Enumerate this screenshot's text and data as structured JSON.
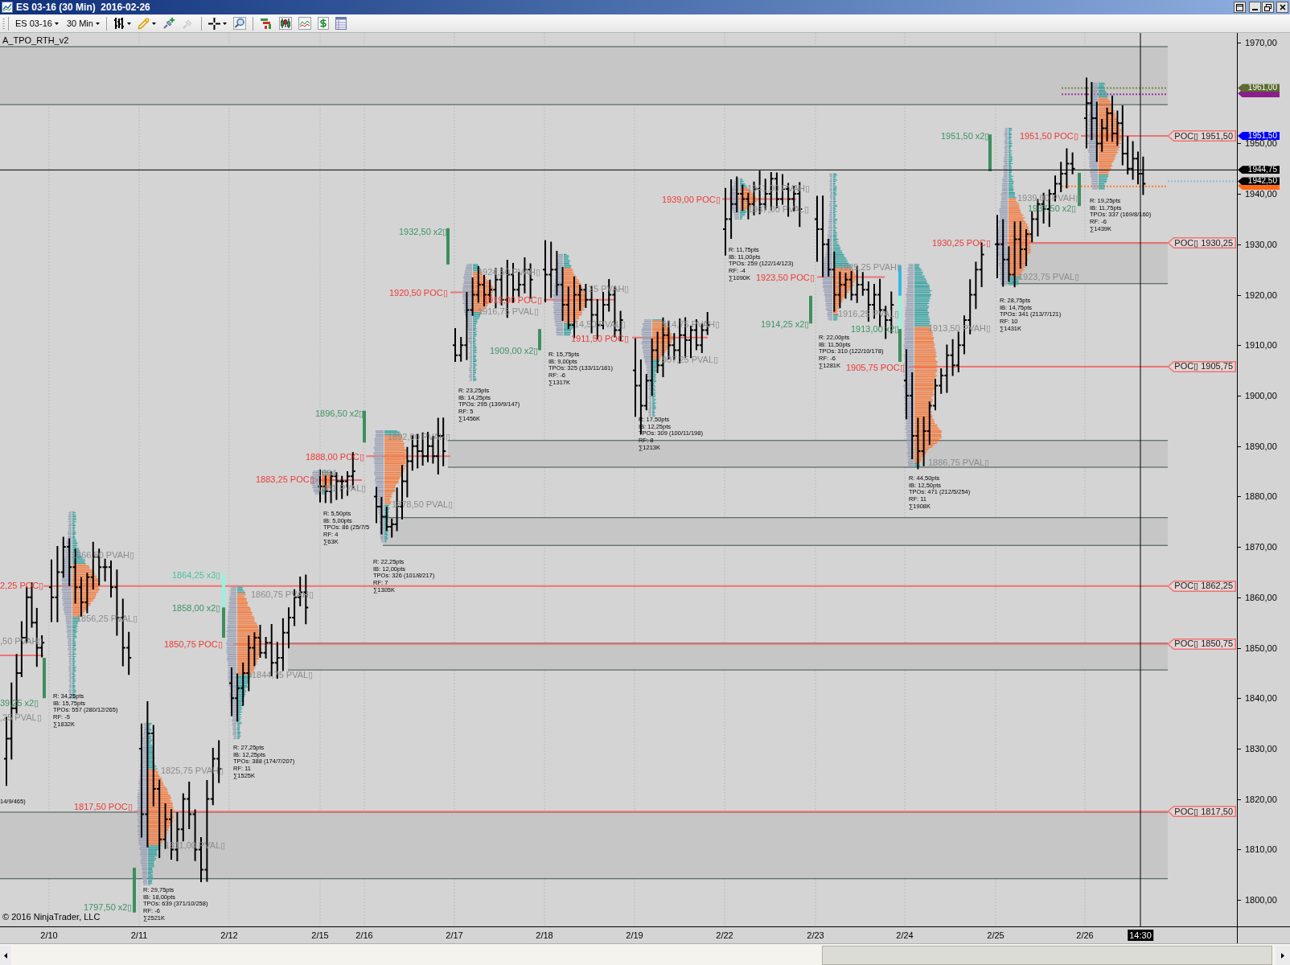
{
  "window": {
    "title": "ES 03-16 (30 Min)  2016-02-26"
  },
  "toolbar": {
    "instrument": "ES 03-16",
    "interval": "30 Min",
    "tools": [
      {
        "kind": "bar-style",
        "disabled": false,
        "dropdown": true
      },
      {
        "kind": "draw",
        "disabled": false,
        "dropdown": true
      },
      {
        "kind": "add-pin",
        "disabled": false,
        "dropdown": false
      },
      {
        "kind": "remove-pin",
        "disabled": true,
        "dropdown": false
      },
      {
        "kind": "crosshair",
        "disabled": false,
        "dropdown": true
      },
      {
        "kind": "zoom",
        "disabled": false,
        "dropdown": false
      },
      {
        "kind": "strategy",
        "disabled": false,
        "dropdown": false
      },
      {
        "kind": "candles",
        "disabled": false,
        "dropdown": false
      },
      {
        "kind": "indicators",
        "disabled": false,
        "dropdown": false
      },
      {
        "kind": "dollar",
        "disabled": false,
        "dropdown": false
      },
      {
        "kind": "data-box",
        "disabled": false,
        "dropdown": false
      }
    ]
  },
  "chart": {
    "indicator": "A_TPO_RTH_v2",
    "copyright": "© 2016 NinjaTrader, LLC",
    "labels": [
      {
        "kind": "single",
        "text": "1951,50 x2▯"
      },
      {
        "kind": "poc",
        "text": "1951,50 POC▯"
      },
      {
        "kind": "value-area",
        "text": "1941,00 PVAH▯"
      },
      {
        "kind": "poc",
        "text": "1939,00 POC▯"
      },
      {
        "kind": "value-area",
        "text": "1939,00 PVAH▯"
      },
      {
        "kind": "value-area",
        "text": "1937,00 PVAL▯"
      },
      {
        "kind": "single",
        "text": "1937,50 x2▯"
      },
      {
        "kind": "single",
        "text": "1932,50 x2▯"
      },
      {
        "kind": "poc",
        "text": "1930,25 POC▯"
      },
      {
        "kind": "value-area",
        "text": "1924,50 PVAH▯"
      },
      {
        "kind": "poc",
        "text": "1923,50 POC▯"
      },
      {
        "kind": "value-area",
        "text": "1925,25 PVAH▯"
      },
      {
        "kind": "value-area",
        "text": "1923,75 PVAL▯"
      },
      {
        "kind": "poc",
        "text": "1920,50 POC▯"
      },
      {
        "kind": "poc",
        "text": "1919,00 POC▯"
      },
      {
        "kind": "value-area",
        "text": "25 PVAH▯"
      },
      {
        "kind": "value-area",
        "text": "1916,75 PVAL▯"
      },
      {
        "kind": "value-area",
        "text": "1916,25 PVAL▯"
      },
      {
        "kind": "value-area",
        "text": "14,50 PVAL▯"
      },
      {
        "kind": "value-area",
        "text": "914,75 PVAH▯"
      },
      {
        "kind": "single",
        "text": "1914,25 x2▯"
      },
      {
        "kind": "single",
        "text": "1913,00 x2▯"
      },
      {
        "kind": "value-area",
        "text": "1913,50 PVAH▯"
      },
      {
        "kind": "poc",
        "text": "1911,50 POC▯"
      },
      {
        "kind": "single",
        "text": "1909,00 x2▯"
      },
      {
        "kind": "value-area",
        "text": "907,25 PVAL▯"
      },
      {
        "kind": "poc",
        "text": "1905,75 POC▯"
      },
      {
        "kind": "single",
        "text": "1896,50 x2▯"
      },
      {
        "kind": "value-area",
        "text": "1892,00 PVAH▯"
      },
      {
        "kind": "poc",
        "text": "1888,00 POC▯"
      },
      {
        "kind": "value-area",
        "text": "1886,75 PVAL▯"
      },
      {
        "kind": "poc",
        "text": "1883,25 POC▯"
      },
      {
        "kind": "value-area",
        "text": "1884,"
      },
      {
        "kind": "value-area",
        "text": "1881"
      },
      {
        "kind": "value-area",
        "text": "PVAL▯"
      },
      {
        "kind": "value-area",
        "text": "1878,50 PVAL▯"
      },
      {
        "kind": "value-area",
        "text": "1866,50 PVAH▯"
      },
      {
        "kind": "faint",
        "text": "1864,25 x3▯"
      },
      {
        "kind": "poc",
        "text": "2,25 POC▯"
      },
      {
        "kind": "value-area",
        "text": "1860,75 PVAH▯"
      },
      {
        "kind": "single",
        "text": "1858,00 x2▯"
      },
      {
        "kind": "value-area",
        "text": "1856,25 PVAL▯"
      },
      {
        "kind": "value-area",
        "text": ",50 PVAH▯"
      },
      {
        "kind": "poc",
        "text": "1850,75 POC▯"
      },
      {
        "kind": "value-area",
        "text": "1844,75 PVAL▯"
      },
      {
        "kind": "single",
        "text": "39,25 x2▯"
      },
      {
        "kind": "value-area",
        "text": ",25 PVAL▯"
      },
      {
        "kind": "value-area",
        "text": "1825,75 PVAH▯"
      },
      {
        "kind": "info",
        "text": "14/9/465)"
      },
      {
        "kind": "poc",
        "text": "1817,50 POC▯"
      },
      {
        "kind": "value-area",
        "text": "1811,00 PVAL▯"
      },
      {
        "kind": "single",
        "text": "1797,50 x2▯"
      }
    ],
    "session_stats": [
      [
        "R: 34,25pts",
        "IB: 15,75pts",
        "TPOs: 557 (280/12/265)",
        "RF: -5",
        "∑1832K"
      ],
      [
        "R: 29,75pts",
        "IB: 18,00pts",
        "TPOs: 639 (371/10/258)",
        "RF: -6",
        "∑2521K"
      ],
      [
        "R: 27,25pts",
        "IB: 12,25pts",
        "TPOs: 388 (174/7/207)",
        "RF: 11",
        "∑1525K"
      ],
      [
        "R: 5,50pts",
        "IB: 5,00pts",
        "TPOs: 86 (25/7/5",
        "RF: 4",
        "∑63K"
      ],
      [
        "R: 22,25pts",
        "IB: 12,00pts",
        "TPOs: 326 (101/8/217)",
        "RF: 7",
        "∑1305K"
      ],
      [
        "R: 23,25pts",
        "IB: 14,25pts",
        "TPOs: 295 (139/9/147)",
        "RF: 5",
        "∑1456K"
      ],
      [
        "R: 15,75pts",
        "IB: 9,00pts",
        "TPOs: 325 (133/11/181)",
        "RF: -6",
        "∑1317K"
      ],
      [
        "R: 17,50pts",
        "IB: 12,25pts",
        "TPOs: 309 (100/11/198)",
        "RF: 8",
        "∑1213K"
      ],
      [
        "R: 11,75pts",
        "IB: 11,00pts",
        "TPOs: 259 (122/14/123)",
        "RF: -4",
        "∑1090K"
      ],
      [
        "R: 22,00pts",
        "IB: 11,50pts",
        "TPOs: 310 (122/10/178)",
        "RF: -6",
        "∑1281K"
      ],
      [
        "R: 44,50pts",
        "IB: 12,50pts",
        "TPOs: 471 (212/5/254)",
        "RF: 11",
        "∑1908K"
      ],
      [
        "R: 28,75pts",
        "IB: 14,75pts",
        "TPOs: 341 (213/7/121)",
        "RF: 10",
        "∑1431K"
      ],
      [
        "R: 19,25pts",
        "IB: 11,75pts",
        "TPOs: 337 (169/8/160)",
        "RF: -6",
        "∑1439K"
      ]
    ],
    "poc_tags": [
      "POC▯ 1951,50",
      "POC▯ 1930,25",
      "POC▯ 1905,75",
      "POC▯ 1862,25",
      "POC▯ 1850,75",
      "POC▯ 1817,50"
    ],
    "price_axis": {
      "ticks": [
        "1970,00",
        "1950,00",
        "1940,00",
        "1930,00",
        "1920,00",
        "1910,00",
        "1900,00",
        "1890,00",
        "1880,00",
        "1870,00",
        "1860,00",
        "1850,00",
        "1840,00",
        "1830,00",
        "1820,00",
        "1810,00",
        "1800,00"
      ],
      "markers": [
        {
          "label": "1961,00",
          "color": "#5c6b2f"
        },
        {
          "label": "1951,50",
          "color": "#0000ff"
        },
        {
          "label": "1944,75",
          "color": "#000000"
        },
        {
          "label": "1942,50",
          "color": "#000000"
        }
      ]
    },
    "time_axis": {
      "labels": [
        "2/10",
        "2/11",
        "2/12",
        "2/15",
        "2/16",
        "2/17",
        "2/18",
        "2/19",
        "2/22",
        "2/23",
        "2/24",
        "2/25",
        "2/26"
      ],
      "cursor": "14:30"
    }
  }
}
